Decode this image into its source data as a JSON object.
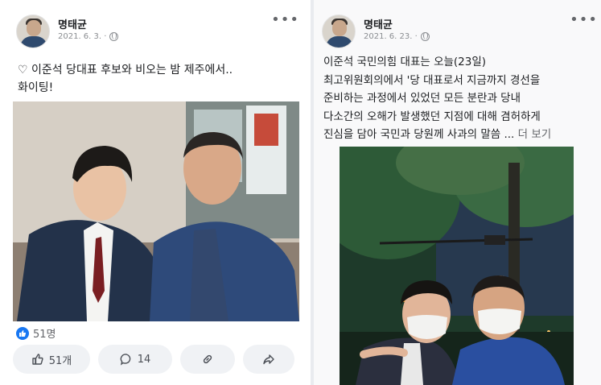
{
  "left_post": {
    "author": "명태균",
    "date": "2021. 6. 3. ·",
    "text_line1": "♡ 이준석 당대표 후보와 비오는 밤 제주에서..",
    "text_line2": "화이팅!",
    "reaction_count": "51명",
    "actions": {
      "like_count": "51개",
      "comment_count": "14"
    }
  },
  "right_post": {
    "author": "명태균",
    "date": "2021. 6. 23. ·",
    "lines": [
      "이준석 국민의힘 대표는 오늘(23일)",
      "최고위원회의에서 '당 대표로서 지금까지 경선을",
      "준비하는 과정에서 있었던 모든 분란과 당내",
      "다소간의 오해가 발생했던 지점에 대해 겸허하게",
      "진심을 담아 국민과 당원께 사과의 말씀 ..."
    ],
    "see_more": "더 보기"
  },
  "colors": {
    "accent": "#1877f2",
    "text": "#1c1e21",
    "muted": "#65676b",
    "button_bg": "#f0f2f5"
  },
  "icons": [
    "globe-icon",
    "more-icon",
    "like-icon",
    "comment-icon",
    "link-icon",
    "share-icon"
  ]
}
